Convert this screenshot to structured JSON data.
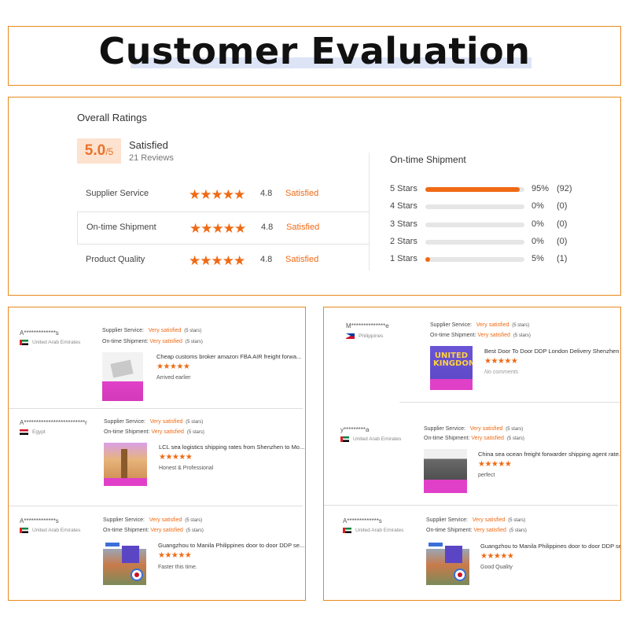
{
  "header": {
    "title": "Customer Evaluation"
  },
  "overall": {
    "label": "Overall Ratings",
    "score": "5.0",
    "score_den": "/5",
    "satisfaction": "Satisfied",
    "reviews": "21 Reviews",
    "rows": [
      {
        "label": "Supplier Service",
        "stars": "★★★★★",
        "rating": 5,
        "score": "4.8",
        "status": "Satisfied"
      },
      {
        "label": "On-time Shipment",
        "stars": "★★★★★",
        "rating": 5,
        "score": "4.8",
        "status": "Satisfied"
      },
      {
        "label": "Product Quality",
        "stars": "★★★★★",
        "rating": 5,
        "score": "4.8",
        "status": "Satisfied"
      }
    ]
  },
  "shipment": {
    "title": "On-time Shipment",
    "breakdown": [
      {
        "label": "5  Stars",
        "pct_value": 95,
        "pct": "95%",
        "count": "(92)"
      },
      {
        "label": "4  Stars",
        "pct_value": 0,
        "pct": "0%",
        "count": "(0)"
      },
      {
        "label": "3  Stars",
        "pct_value": 0,
        "pct": "0%",
        "count": "(0)"
      },
      {
        "label": "2  Stars",
        "pct_value": 0,
        "pct": "0%",
        "count": "(0)"
      },
      {
        "label": "1  Stars",
        "pct_value": 5,
        "pct": "5%",
        "count": "(1)"
      }
    ]
  },
  "labels": {
    "supplier_service": "Supplier Service:",
    "ontime_shipment": "On-time Shipment:",
    "very_satisfied": "Very satisfied",
    "five_stars": "(5 stars)",
    "review_stars": "★★★★★"
  },
  "colors": {
    "accent": "#f06a14",
    "border": "#e8891c",
    "badge_bg": "#fde2cf"
  },
  "reviews_left": [
    {
      "user": "A*************s",
      "flag": "uae-flag-icon",
      "country": "United Arab Emirates",
      "product": "Cheap customs broker amazon FBA AIR freight forwa...",
      "comment": "Arrived earlier",
      "rating": 5
    },
    {
      "user": "A*************************r",
      "flag": "egypt-flag-icon",
      "country": "Egypt",
      "product": "LCL sea logistics shipping rates from Shenzhen to Mo...",
      "comment": "Honest & Professional",
      "rating": 5
    },
    {
      "user": "A*************s",
      "flag": "uae-flag-icon",
      "country": "United Arab Emirates",
      "product": "Guangzhou to Manila Philippines door to door DDP se...",
      "comment": "Faster this time.",
      "rating": 5
    }
  ],
  "reviews_right": [
    {
      "user": "M**************e",
      "flag": "philippines-flag-icon",
      "country": "Philippines",
      "product": "Best Door To Door DDP London Delivery Shenzhen To",
      "comment": "No comments",
      "rating": 5,
      "thumb_text": "UNITED KINGDOM"
    },
    {
      "user": "y*********a",
      "flag": "uae-flag-icon",
      "country": "United Arab Emirates",
      "product": "China sea ocean freight forwarder shipping agent rate...",
      "comment": "perfect",
      "rating": 5
    },
    {
      "user": "A*************s",
      "flag": "uae-flag-icon",
      "country": "United Arab Emirates",
      "product": "Guangzhou to Manila Philippines door to door DDP se...",
      "comment": "Good Quality",
      "rating": 5
    }
  ]
}
